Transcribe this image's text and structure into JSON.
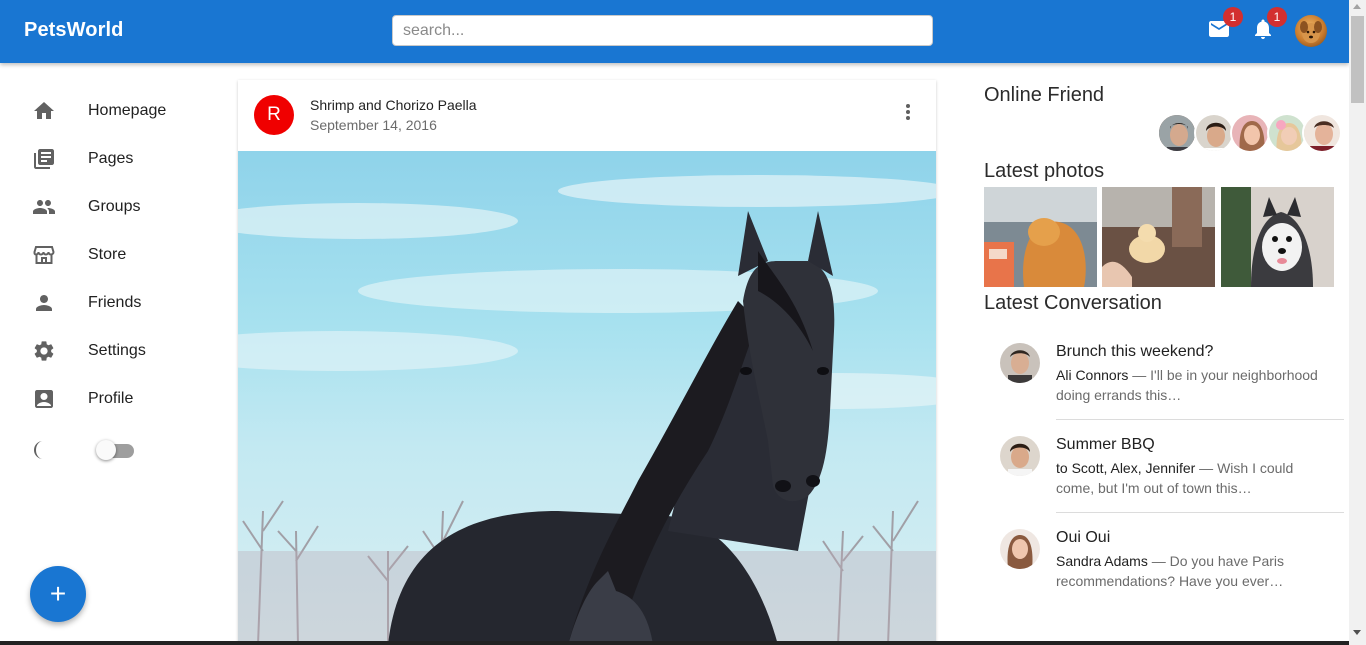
{
  "app": {
    "brand": "PetsWorld"
  },
  "search": {
    "placeholder": "search..."
  },
  "header": {
    "mail_badge": "1",
    "notification_badge": "1"
  },
  "sidebar": {
    "items": [
      {
        "label": "Homepage",
        "icon": "home-icon"
      },
      {
        "label": "Pages",
        "icon": "pages-icon"
      },
      {
        "label": "Groups",
        "icon": "groups-icon"
      },
      {
        "label": "Store",
        "icon": "store-icon"
      },
      {
        "label": "Friends",
        "icon": "person-icon"
      },
      {
        "label": "Settings",
        "icon": "gear-icon"
      },
      {
        "label": "Profile",
        "icon": "profile-icon"
      }
    ],
    "dark_mode": {
      "icon": "moon-icon",
      "enabled": false
    },
    "fab_icon": "+"
  },
  "post": {
    "avatar_letter": "R",
    "title": "Shrimp and Chorizo Paella",
    "date": "September 14, 2016"
  },
  "right": {
    "online_heading": "Online Friend",
    "photos_heading": "Latest photos",
    "conversation_heading": "Latest Conversation",
    "conversations": [
      {
        "title": "Brunch this weekend?",
        "who": "Ali Connors",
        "text": " — I'll be in your neighborhood doing errands this…"
      },
      {
        "title": "Summer BBQ",
        "who": "to Scott, Alex, Jennifer",
        "text": " — Wish I could come, but I'm out of town this…"
      },
      {
        "title": "Oui Oui",
        "who": "Sandra Adams",
        "text": " — Do you have Paris recommendations? Have you ever…"
      }
    ]
  },
  "colors": {
    "primary": "#1976d2",
    "badge": "#d32f2f",
    "post_avatar": "#f00000"
  }
}
